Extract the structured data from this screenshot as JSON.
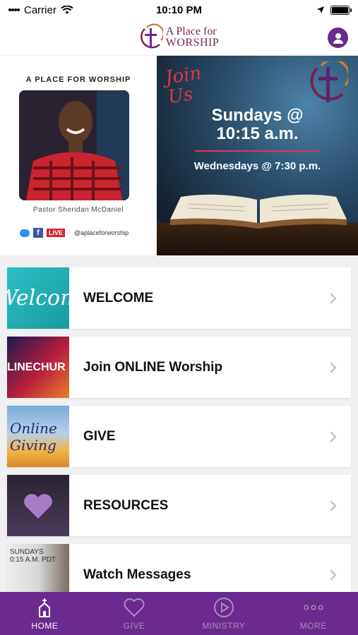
{
  "status_bar": {
    "carrier": "Carrier",
    "time": "10:10 PM"
  },
  "header": {
    "logo_line1": "A Place for",
    "logo_line2": "WORSHIP"
  },
  "hero": {
    "left_title": "A PLACE FOR WORSHIP",
    "pastor_caption": "Pastor Sheridan McDaniel",
    "live_badge": "LIVE",
    "social_handle": "@aplaceforworship",
    "join_line1": "Join",
    "join_line2": "Us",
    "sunday_line1": "Sundays @",
    "sunday_line2": "10:15 a.m.",
    "wednesday": "Wednesdays @ 7:30 p.m."
  },
  "menu": {
    "items": [
      {
        "label": "WELCOME",
        "thumb_text": "Welcom"
      },
      {
        "label": "Join ONLINE Worship",
        "thumb_text": "LINECHUR"
      },
      {
        "label": "GIVE",
        "thumb_text_1": "Online",
        "thumb_text_2": "Giving"
      },
      {
        "label": "RESOURCES"
      },
      {
        "label": "Watch Messages",
        "thumb_text_1": "SUNDAYS",
        "thumb_text_2": "0:15 A.M. PDT"
      }
    ]
  },
  "tab_bar": {
    "tabs": [
      {
        "label": "HOME",
        "icon": "church-icon"
      },
      {
        "label": "GIVE",
        "icon": "heart-icon"
      },
      {
        "label": "MINISTRY",
        "icon": "play-icon"
      },
      {
        "label": "MORE",
        "icon": "more-icon"
      }
    ]
  },
  "colors": {
    "brand_purple": "#6a2a8f",
    "logo_maroon": "#7b1e4f",
    "accent_red": "#e03744"
  }
}
